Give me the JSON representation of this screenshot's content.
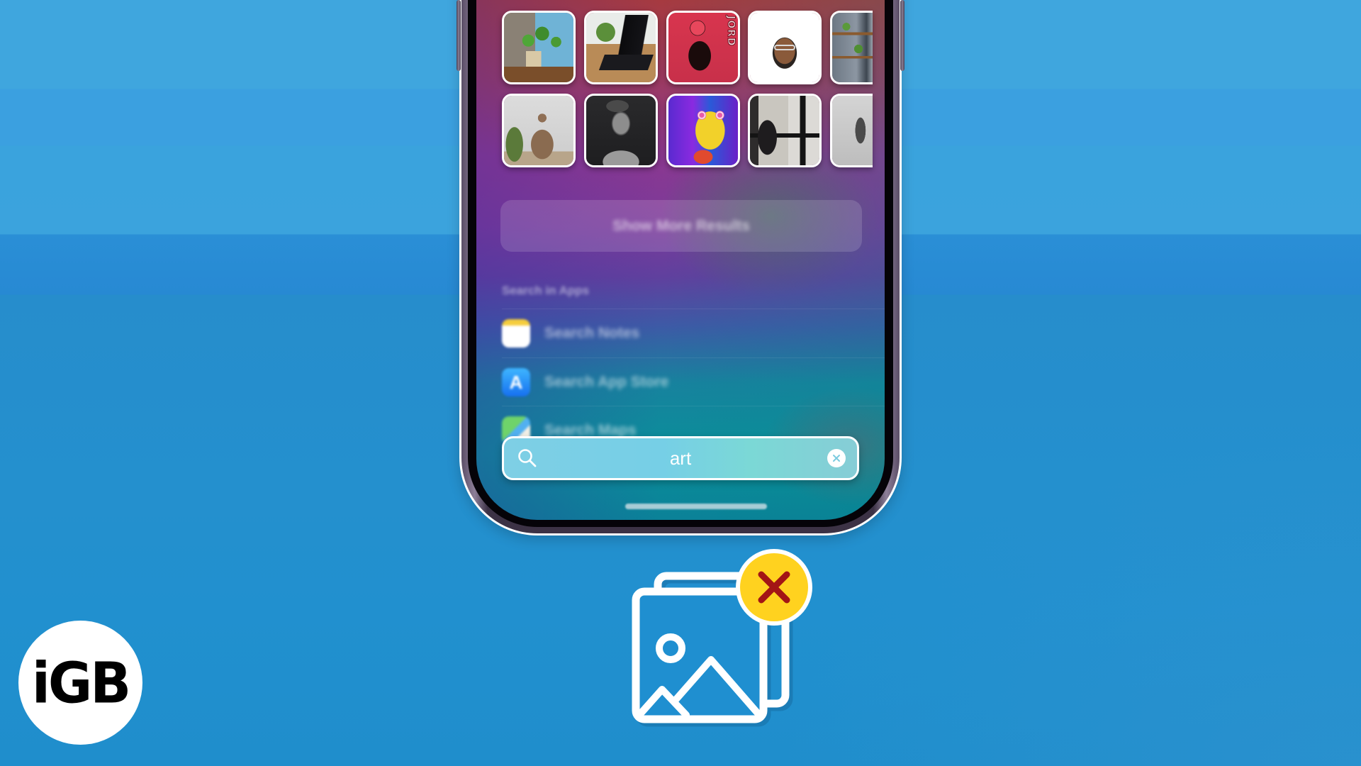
{
  "brand": {
    "logo_text": "iGB",
    "background_color": "#2a95d6"
  },
  "spotlight": {
    "photo_results": [
      {
        "name": "plant-in-pot-photo"
      },
      {
        "name": "laptop-with-plant-photo"
      },
      {
        "name": "jordan-art-poster"
      },
      {
        "name": "memoji-portrait"
      },
      {
        "name": "shelf-with-plants-photo"
      },
      {
        "name": "statue-photo"
      },
      {
        "name": "david-sculpture-photo"
      },
      {
        "name": "psychedelic-cartoon-art"
      },
      {
        "name": "person-at-window-photo"
      },
      {
        "name": "hands-photo"
      }
    ],
    "show_more_label": "Show More Results",
    "section_header": "Search in Apps",
    "app_rows": [
      {
        "label": "Search Notes",
        "icon": "notes-icon"
      },
      {
        "label": "Search App Store",
        "icon": "app-store-icon"
      },
      {
        "label": "Search Maps",
        "icon": "maps-icon"
      }
    ],
    "search": {
      "value": "art",
      "clear_icon": "clear-icon"
    }
  },
  "feature_icon": {
    "name": "photo-removed-icon",
    "badge_color": "#ffd21f",
    "x_color": "#a31515"
  }
}
